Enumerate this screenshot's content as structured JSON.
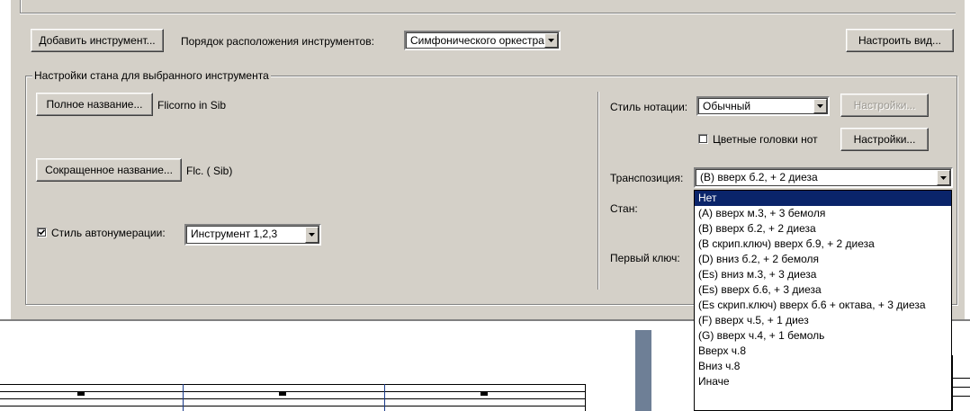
{
  "toolbar": {
    "add_instrument": "Добавить инструмент...",
    "order_label": "Порядок расположения инструментов:",
    "order_value": "Симфонического оркестра",
    "configure_view": "Настроить вид..."
  },
  "staff_settings": {
    "group_title": "Настройки стана для выбранного инструмента",
    "full_name_button": "Полное название...",
    "full_name_value": "Flicorno in Sib",
    "short_name_button": "Сокращенное название...",
    "short_name_value": "Flc. ( Sib)",
    "autonum_checkbox_label": "Стиль автонумерации:",
    "autonum_checked": true,
    "autonum_value": "Инструмент 1,2,3",
    "notation_style_label": "Стиль нотации:",
    "notation_style_value": "Обычный",
    "notation_settings_disabled": "Настройки...",
    "color_heads_label": "Цветные головки нот",
    "color_heads_checked": false,
    "color_heads_settings": "Настройки...",
    "transposition_label": "Транспозиция:",
    "transposition_value": "(B) вверх б.2, + 2 диеза",
    "staff_label": "Стан:",
    "first_clef_label": "Первый ключ:"
  },
  "transposition_options": [
    {
      "label": "Нет",
      "selected": true
    },
    {
      "label": "(A) вверх м.3, + 3 бемоля",
      "selected": false
    },
    {
      "label": "(B) вверх б.2, + 2 диеза",
      "selected": false
    },
    {
      "label": "(B скрип.ключ) вверх б.9, + 2 диеза",
      "selected": false
    },
    {
      "label": "(D) вниз б.2, + 2 бемоля",
      "selected": false
    },
    {
      "label": "(Es) вниз м.3, + 3 диеза",
      "selected": false
    },
    {
      "label": "(Es) вверх б.6, + 3 диеза",
      "selected": false
    },
    {
      "label": "(Es скрип.ключ) вверх б.6 + октава, + 3 диеза",
      "selected": false
    },
    {
      "label": "(F) вверх ч.5, + 1 диез",
      "selected": false
    },
    {
      "label": "(G) вверх ч.4, + 1 бемоль",
      "selected": false
    },
    {
      "label": "Вверх ч.8",
      "selected": false
    },
    {
      "label": "Вниз ч.8",
      "selected": false
    },
    {
      "label": "Иначе",
      "selected": false
    }
  ],
  "icons": {
    "dropdown_arrow": "chevron-down-icon",
    "checkmark": "check-icon"
  },
  "colors": {
    "dialog_bg": "#d4d0c8",
    "selection": "#0a246a",
    "score_sidebar": "#6e7f96"
  }
}
